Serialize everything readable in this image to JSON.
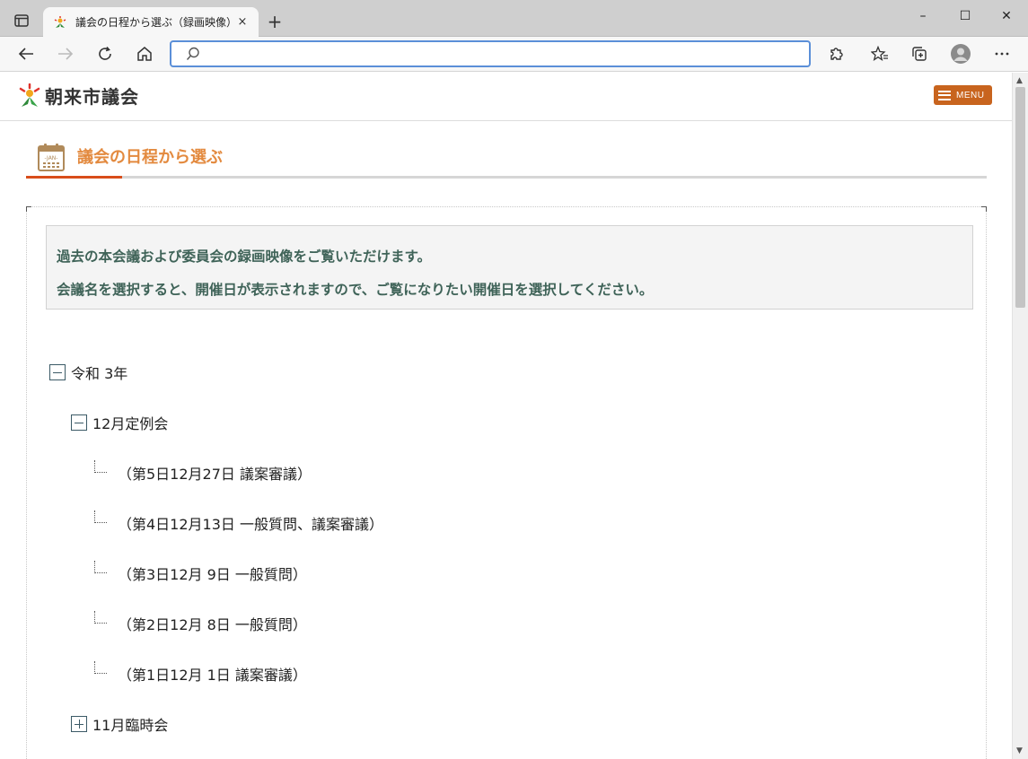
{
  "browser": {
    "tab_title": "議会の日程から選ぶ（録画映像）",
    "tab_close": "×",
    "new_tab": "+",
    "address_value": "",
    "window_controls": {
      "minimize": "–",
      "maximize": "☐",
      "close": "✕"
    },
    "toolbar_icons": [
      "back-icon",
      "forward-icon",
      "refresh-icon",
      "home-icon",
      "extensions-icon",
      "favorites-icon",
      "collections-icon",
      "profile-icon",
      "more-icon"
    ]
  },
  "site": {
    "logo_text": "朝来市議会",
    "menu_label": "MENU"
  },
  "section": {
    "title": "議会の日程から選ぶ",
    "calendar_label": "-JAN-"
  },
  "notice": {
    "line1": "過去の本会議および委員会の録画映像をご覧いただけます。",
    "line2": "会議名を選択すると、開催日が表示されますので、ご覧になりたい開催日を選択してください。"
  },
  "tree": {
    "year": {
      "label": "令和 3年",
      "expanded": true
    },
    "sessions": [
      {
        "label": "12月定例会",
        "expanded": true,
        "days": [
          "（第5日12月27日 議案審議）",
          "（第4日12月13日 一般質問、議案審議）",
          "（第3日12月 9日 一般質問）",
          "（第2日12月 8日 一般質問）",
          "（第1日12月 1日 議案審議）"
        ]
      },
      {
        "label": "11月臨時会",
        "expanded": false,
        "days": []
      }
    ]
  },
  "colors": {
    "accent_orange": "#c8641e",
    "title_orange": "#e38a3f",
    "underline_red": "#d84d1a",
    "notice_text": "#3f6358"
  }
}
